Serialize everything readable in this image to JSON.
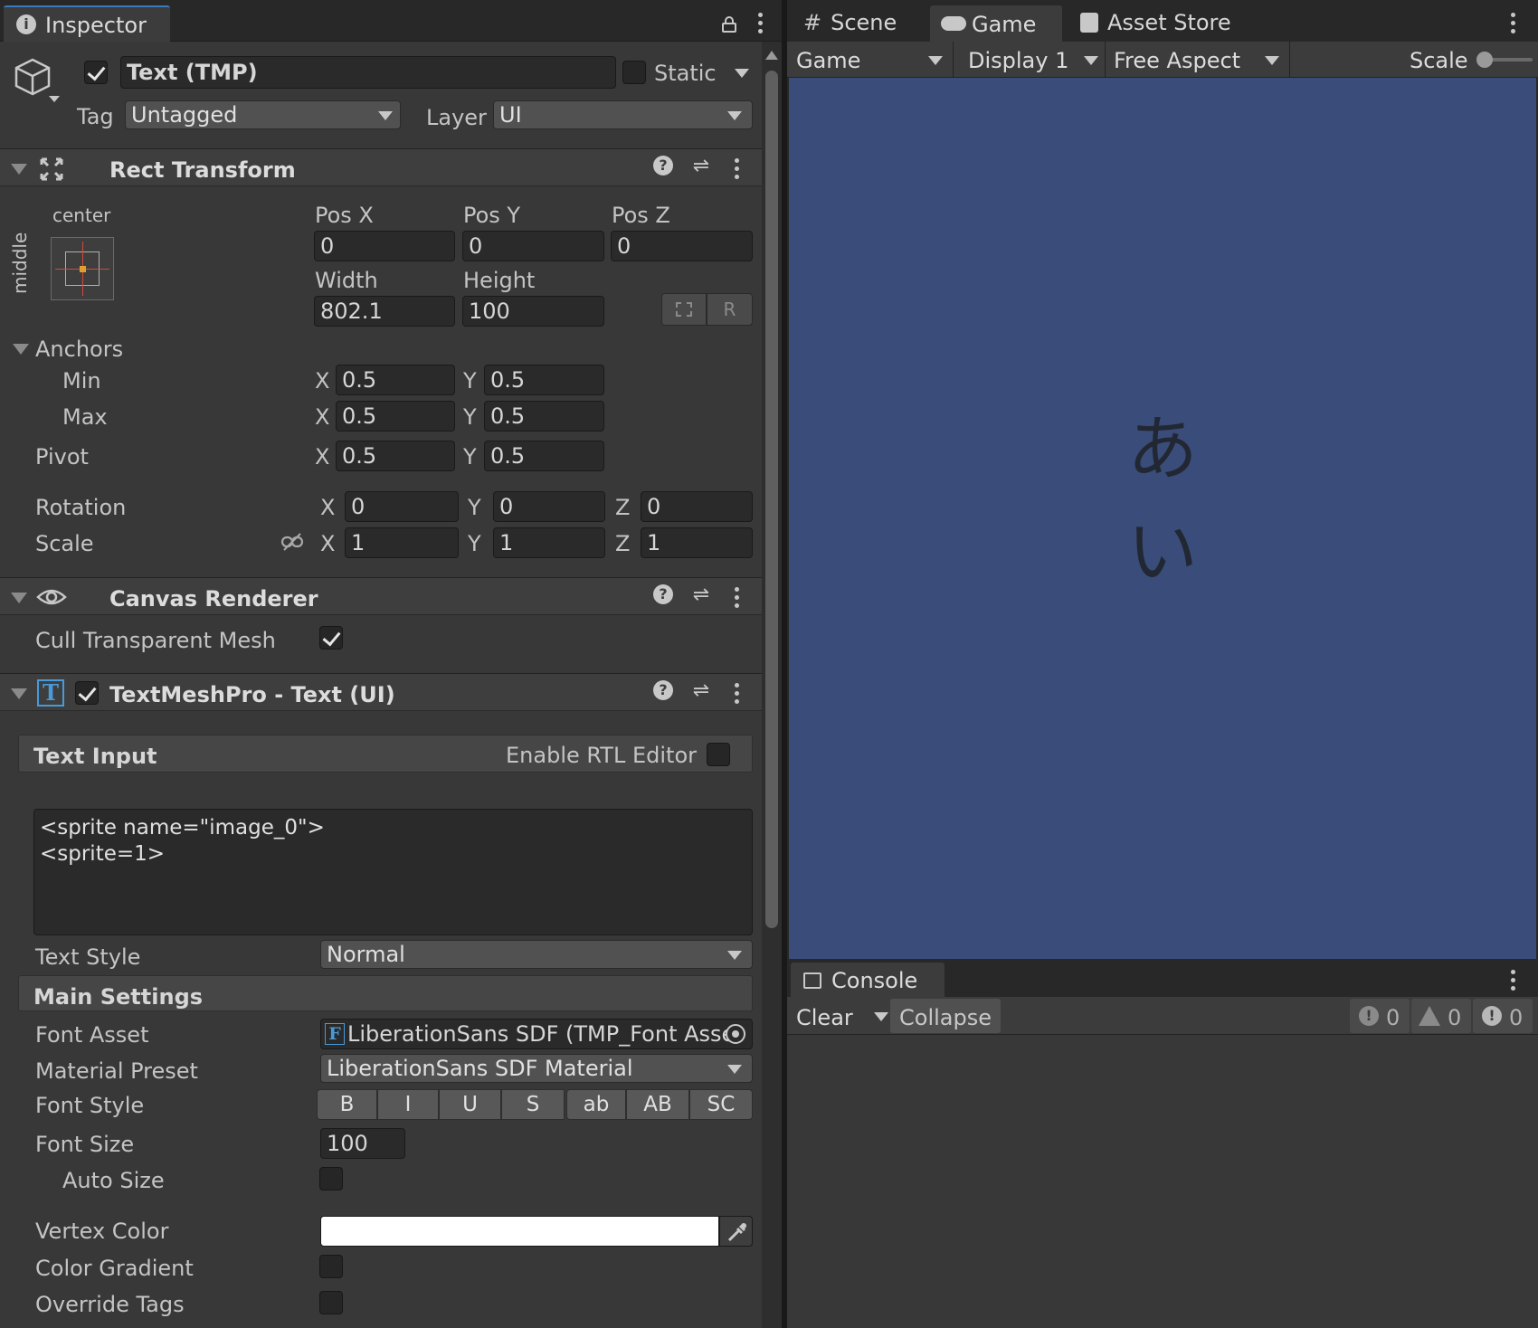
{
  "inspector": {
    "tab_label": "Inspector",
    "object": {
      "active": true,
      "name": "Text (TMP)",
      "static_label": "Static",
      "static_checked": false,
      "tag_label": "Tag",
      "tag_value": "Untagged",
      "layer_label": "Layer",
      "layer_value": "UI"
    },
    "rect_transform": {
      "title": "Rect Transform",
      "anchor_h": "center",
      "anchor_v": "middle",
      "pos_x_label": "Pos X",
      "pos_y_label": "Pos Y",
      "pos_z_label": "Pos Z",
      "pos_x": "0",
      "pos_y": "0",
      "pos_z": "0",
      "width_label": "Width",
      "height_label": "Height",
      "width": "802.1",
      "height": "100",
      "raw_button": "R",
      "anchors_label": "Anchors",
      "min_label": "Min",
      "max_label": "Max",
      "min_x": "0.5",
      "min_y": "0.5",
      "max_x": "0.5",
      "max_y": "0.5",
      "pivot_label": "Pivot",
      "pivot_x": "0.5",
      "pivot_y": "0.5",
      "rotation_label": "Rotation",
      "rot_x": "0",
      "rot_y": "0",
      "rot_z": "0",
      "scale_label": "Scale",
      "scale_x": "1",
      "scale_y": "1",
      "scale_z": "1",
      "axis_x": "X",
      "axis_y": "Y",
      "axis_z": "Z"
    },
    "canvas_renderer": {
      "title": "Canvas Renderer",
      "cull_label": "Cull Transparent Mesh",
      "cull_checked": true
    },
    "tmp": {
      "title": "TextMeshPro - Text (UI)",
      "enabled": true,
      "text_input_label": "Text Input",
      "rtl_label": "Enable RTL Editor",
      "text_line1": "<sprite name=\"image_0\">",
      "text_line2": "<sprite=1>",
      "text_style_label": "Text Style",
      "text_style_value": "Normal",
      "main_settings_label": "Main Settings",
      "font_asset_label": "Font Asset",
      "font_asset_value": "LiberationSans SDF (TMP_Font Asse",
      "material_preset_label": "Material Preset",
      "material_preset_value": "LiberationSans SDF Material",
      "font_style_label": "Font Style",
      "font_style_buttons": [
        "B",
        "I",
        "U",
        "S",
        "ab",
        "AB",
        "SC"
      ],
      "font_size_label": "Font Size",
      "font_size_value": "100",
      "auto_size_label": "Auto Size",
      "vertex_color_label": "Vertex Color",
      "vertex_color": "#ffffff",
      "color_gradient_label": "Color Gradient",
      "override_tags_label": "Override Tags"
    }
  },
  "scene_tabs": {
    "scene": "Scene",
    "game": "Game",
    "asset_store": "Asset Store"
  },
  "game_toolbar": {
    "mode": "Game",
    "display": "Display 1",
    "aspect": "Free Aspect",
    "scale_label": "Scale"
  },
  "game_view": {
    "background": "#3a4d7a",
    "line1": "あ",
    "line2": "い"
  },
  "console": {
    "tab_label": "Console",
    "clear_label": "Clear",
    "collapse_label": "Collapse",
    "log_count": "0",
    "warning_count": "0",
    "error_count": "0"
  }
}
